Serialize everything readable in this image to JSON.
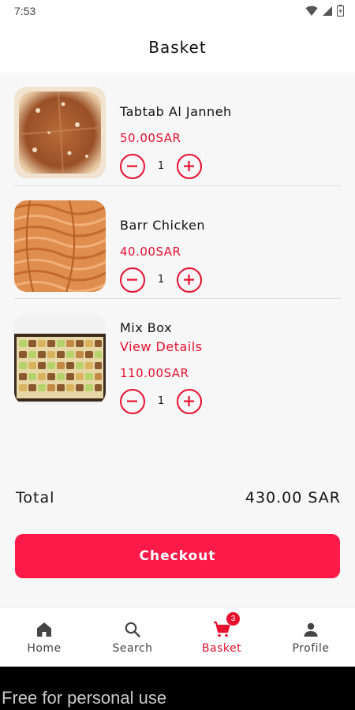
{
  "status_bar": {
    "time": "7:53"
  },
  "header": {
    "title": "Basket"
  },
  "items": [
    {
      "name": "Tabtab Al Janneh",
      "price": "50.00SAR",
      "quantity": "1"
    },
    {
      "name": "Barr Chicken",
      "price": "40.00SAR",
      "quantity": "1"
    },
    {
      "name": "Mix Box",
      "details_link": "View Details",
      "price": "110.00SAR",
      "quantity": "1"
    }
  ],
  "summary": {
    "total_label": "Total",
    "total_value": "430.00 SAR"
  },
  "checkout": {
    "label": "Checkout"
  },
  "nav": {
    "items": [
      {
        "label": "Home",
        "icon": "home-icon"
      },
      {
        "label": "Search",
        "icon": "search-icon"
      },
      {
        "label": "Basket",
        "icon": "cart-icon",
        "badge": "3",
        "active": true
      },
      {
        "label": "Profile",
        "icon": "person-icon"
      }
    ]
  },
  "watermark": {
    "text": "Free for personal use"
  },
  "colors": {
    "accent": "#e8102e",
    "button": "#fe1a48",
    "background": "#f7f7f7"
  }
}
